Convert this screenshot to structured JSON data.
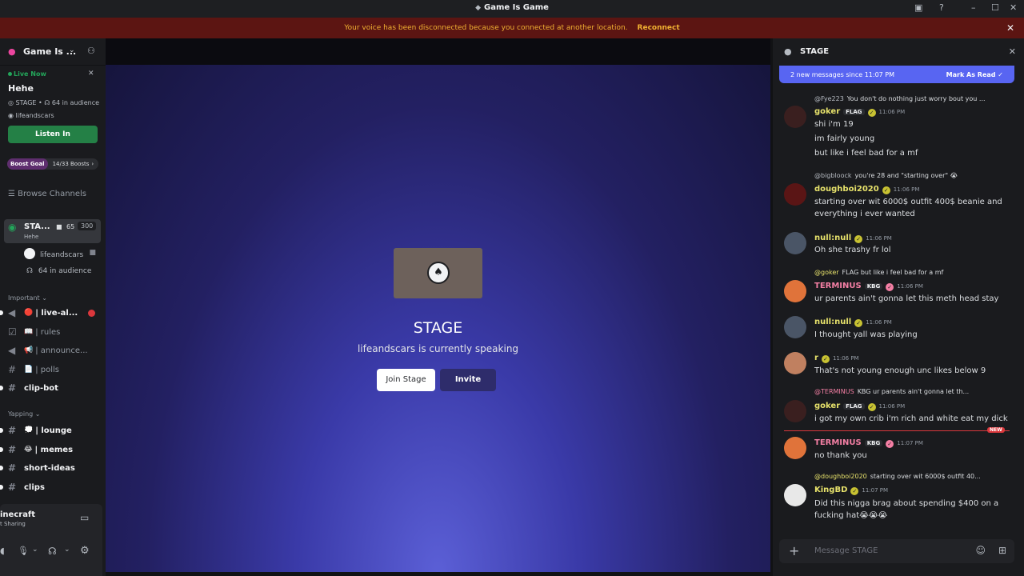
{
  "window": {
    "title": "Game Is Game"
  },
  "banner": {
    "message": "Your voice has been disconnected because you connected at another location.",
    "action": "Reconnect"
  },
  "server": {
    "name": "Game Is ...",
    "live_label": "Live Now",
    "event_title": "Hehe",
    "event_meta": "STAGE • ☊ 64 in audience",
    "event_host": "lifeandscars",
    "listen_label": "Listen In",
    "boost_goal": "Boost Goal",
    "boost_count": "14/33 Boosts",
    "browse": "Browse Channels",
    "stage_channel": {
      "name": "STA...",
      "topic": "Hehe",
      "video_count": "65",
      "capacity": "300"
    },
    "stage_speaker": "lifeandscars",
    "stage_audience": "64 in audience",
    "section_important": "Important",
    "channels_important": [
      {
        "emoji": "🔴",
        "name": "| live-al...",
        "icon": "megaphone-icon"
      },
      {
        "emoji": "📖",
        "name": "| rules",
        "icon": "rules-icon"
      },
      {
        "emoji": "📢",
        "name": "| announce...",
        "icon": "megaphone-icon"
      },
      {
        "emoji": "📄",
        "name": "| polls",
        "icon": "hash-icon"
      },
      {
        "emoji": "",
        "name": "clip-bot",
        "icon": "hash-icon"
      }
    ],
    "section_yapping": "Yapping",
    "channels_yapping": [
      {
        "emoji": "💭",
        "name": "| lounge"
      },
      {
        "emoji": "😂",
        "name": "| memes"
      },
      {
        "emoji": "",
        "name": "short-ideas"
      },
      {
        "emoji": "",
        "name": "clips"
      }
    ],
    "activity": {
      "name": "inecraft",
      "status": "t Sharing"
    }
  },
  "stage": {
    "title": "STAGE",
    "subtitle": "lifeandscars is currently speaking",
    "join_label": "Join Stage",
    "invite_label": "Invite"
  },
  "chat": {
    "title": "STAGE",
    "new_messages": "2 new messages since 11:07 PM",
    "mark_read": "Mark As Read",
    "placeholder": "Message STAGE",
    "new_badge": "NEW",
    "messages": [
      {
        "reply_to": "@Fye223",
        "reply_text": "You don't do nothing just worry bout you ...",
        "author": "goker",
        "tag": "FLAG",
        "time": "11:06 PM",
        "lines": [
          "shi i'm 19",
          "im fairly young",
          "but like i feel bad for a mf"
        ]
      },
      {
        "reply_to": "@bigbloock",
        "reply_text": "you're 28 and \"starting over\" 😭",
        "author": "doughboi2020",
        "tag": "",
        "time": "11:06 PM",
        "lines": [
          "starting over wit 6000$ outfit 400$ beanie and everything i ever wanted"
        ]
      },
      {
        "reply_to": "",
        "reply_text": "",
        "author": "null:null",
        "tag": "",
        "time": "11:06 PM",
        "lines": [
          "Oh she trashy fr lol"
        ]
      },
      {
        "reply_to": "@goker",
        "reply_text": "FLAG but like i feel bad for a mf",
        "author": "TERMINUS",
        "tag": "KBG",
        "time": "11:06 PM",
        "lines": [
          "ur parents ain't gonna let this meth head stay"
        ]
      },
      {
        "reply_to": "",
        "reply_text": "",
        "author": "null:null",
        "tag": "",
        "time": "11:06 PM",
        "lines": [
          "I thought yall was playing"
        ]
      },
      {
        "reply_to": "",
        "reply_text": "",
        "author": "r",
        "tag": "",
        "time": "11:06 PM",
        "lines": [
          "That's not young enough unc likes below 9"
        ]
      },
      {
        "reply_to": "@TERMINUS",
        "reply_text": "KBG ur parents ain't gonna let th...",
        "author": "goker",
        "tag": "FLAG",
        "time": "11:06 PM",
        "lines": [
          "i got my own crib i'm rich and white eat my dick"
        ]
      },
      {
        "reply_to": "",
        "reply_text": "",
        "author": "TERMINUS",
        "tag": "KBG",
        "time": "11:07 PM",
        "lines": [
          "no thank you"
        ]
      },
      {
        "reply_to": "@doughboi2020",
        "reply_text": "starting over wit 6000$ outfit 40...",
        "author": "KingBD",
        "tag": "",
        "time": "11:07 PM",
        "lines": [
          "Did this nigga brag about spending $400 on a fucking hat😭😭😭"
        ]
      }
    ]
  }
}
